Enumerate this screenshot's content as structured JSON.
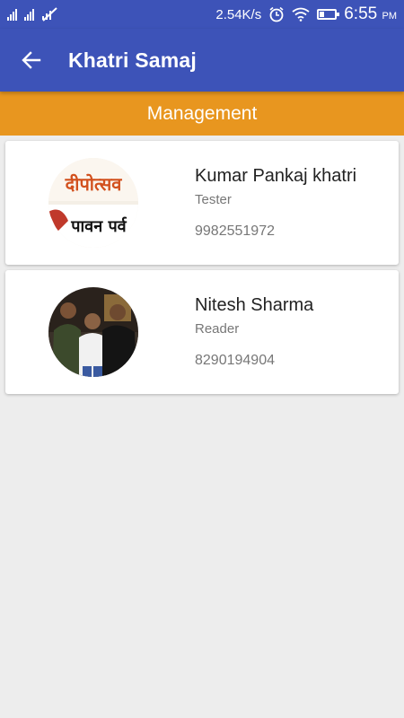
{
  "status_bar": {
    "speed": "2.54K/s",
    "time": "6:55",
    "ampm": "PM",
    "icons": [
      "signal-icon",
      "signal-icon",
      "muted-signal-icon",
      "alarm-icon",
      "wifi-icon",
      "battery-icon"
    ]
  },
  "app_bar": {
    "title": "Khatri Samaj",
    "back_icon": "back-arrow-icon",
    "color": "#3d53b8"
  },
  "section": {
    "title": "Management",
    "color": "#e8961f"
  },
  "members": [
    {
      "name": "Kumar Pankaj khatri",
      "role": "Tester",
      "phone": "9982551972",
      "avatar_text_top": "दीपोत्सव",
      "avatar_text_bottom": "पावन पर्व"
    },
    {
      "name": "Nitesh Sharma",
      "role": "Reader",
      "phone": "8290194904"
    }
  ]
}
